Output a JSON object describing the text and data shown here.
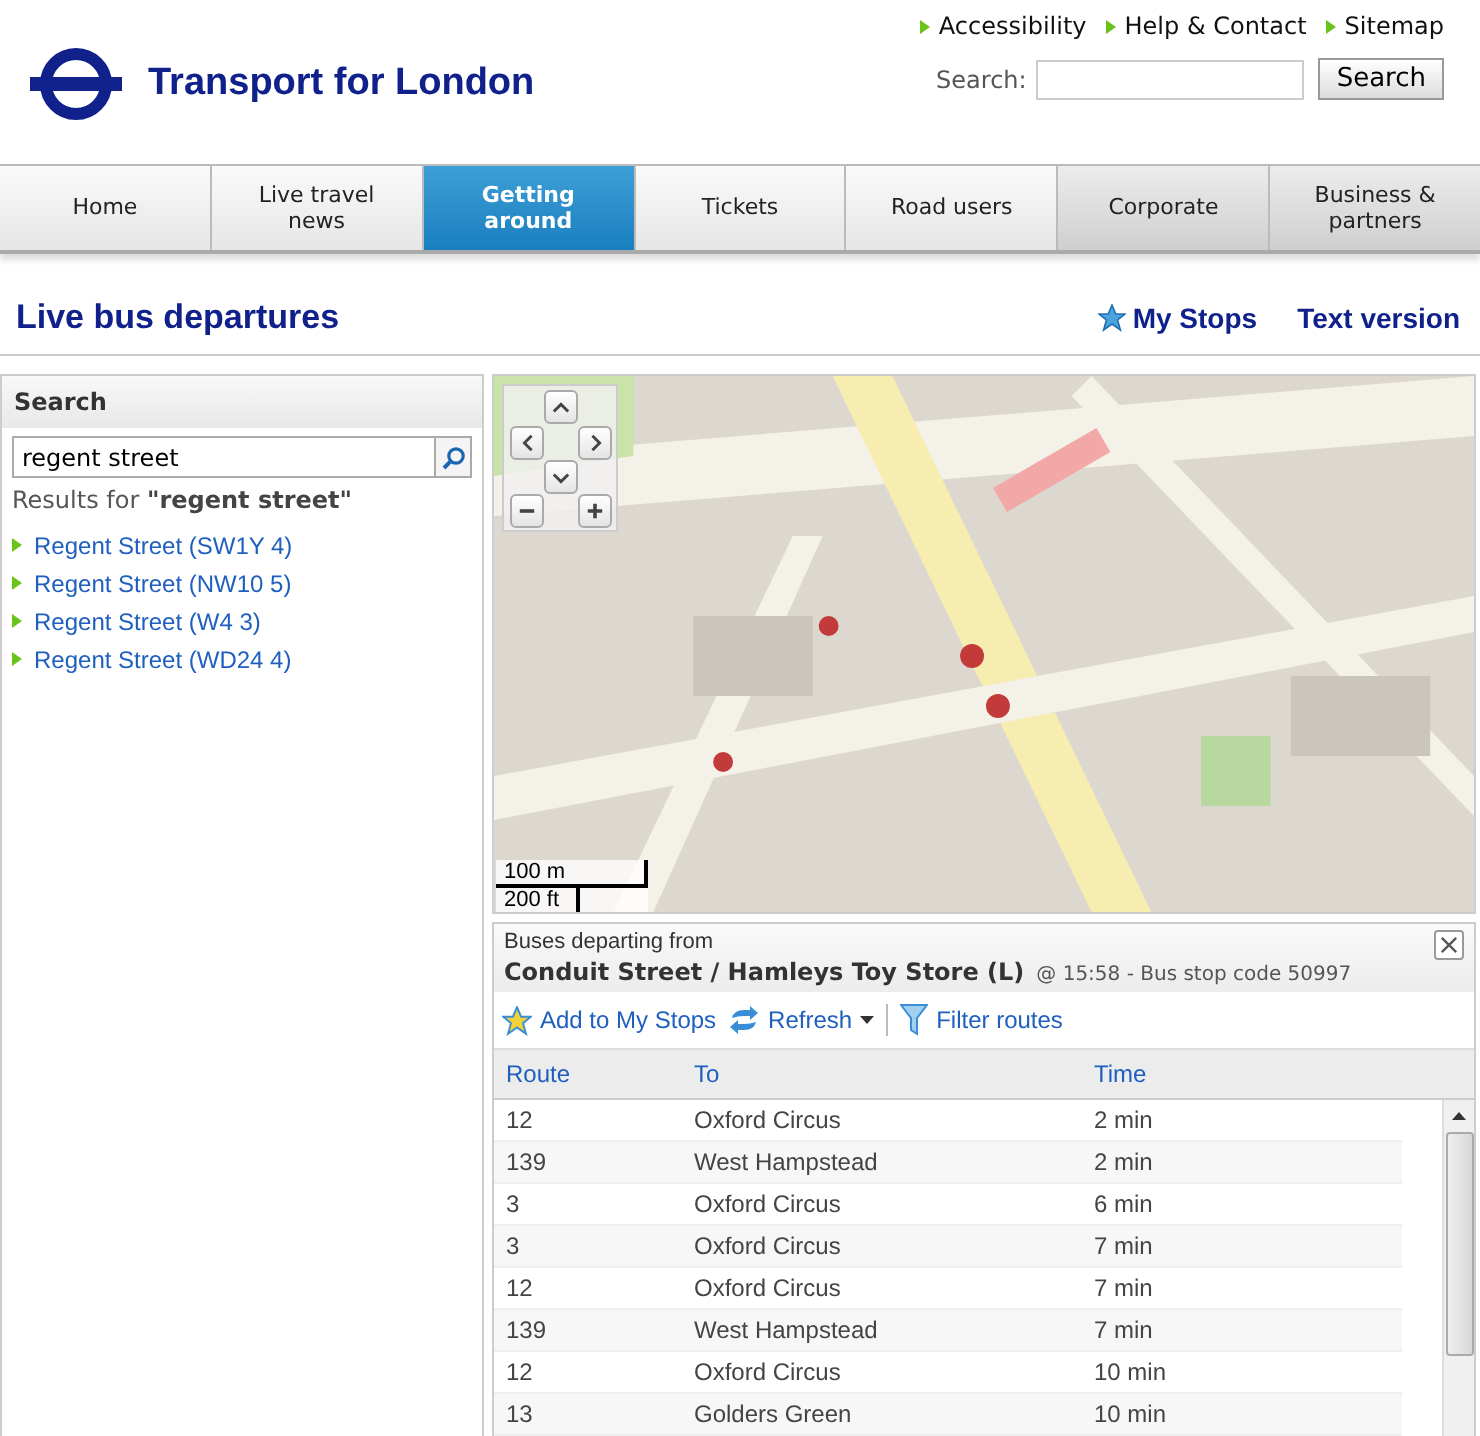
{
  "header": {
    "logo_text": "Transport for London",
    "utility_links": [
      "Accessibility",
      "Help & Contact",
      "Sitemap"
    ],
    "search": {
      "label": "Search:",
      "button": "Search"
    }
  },
  "nav": [
    {
      "label": "Home",
      "selected": false,
      "shaded": false
    },
    {
      "label": "Live travel news",
      "selected": false,
      "shaded": false
    },
    {
      "label": "Getting around",
      "selected": true,
      "shaded": false
    },
    {
      "label": "Tickets",
      "selected": false,
      "shaded": false
    },
    {
      "label": "Road users",
      "selected": false,
      "shaded": false
    },
    {
      "label": "Corporate",
      "selected": false,
      "shaded": true
    },
    {
      "label": "Business & partners",
      "selected": false,
      "shaded": true
    }
  ],
  "page": {
    "title": "Live bus departures",
    "links": [
      "My Stops",
      "Text version"
    ]
  },
  "search_panel": {
    "title": "Search",
    "value": "regent street",
    "results_prefix": "Results for",
    "results_query": "\"regent street\"",
    "results": [
      "Regent Street (SW1Y 4)",
      "Regent Street (NW10 5)",
      "Regent Street (W4 3)",
      "Regent Street (WD24 4)"
    ]
  },
  "map": {
    "kind": "picture",
    "scale": [
      "100 m",
      "200 ft"
    ]
  },
  "departures": {
    "caption": "Buses departing from",
    "stop_name": "Conduit Street / Hamleys Toy Store (L)",
    "stop_info": "@ 15:58 - Bus stop code 50997",
    "actions": [
      "Add to My Stops",
      "Refresh",
      "Filter routes"
    ],
    "columns": [
      "Route",
      "To",
      "Time"
    ],
    "rows": [
      [
        "12",
        "Oxford Circus",
        "2 min"
      ],
      [
        "139",
        "West Hampstead",
        "2 min"
      ],
      [
        "3",
        "Oxford Circus",
        "6 min"
      ],
      [
        "3",
        "Oxford Circus",
        "7 min"
      ],
      [
        "12",
        "Oxford Circus",
        "7 min"
      ],
      [
        "139",
        "West Hampstead",
        "7 min"
      ],
      [
        "12",
        "Oxford Circus",
        "10 min"
      ],
      [
        "13",
        "Golders Green",
        "10 min"
      ]
    ]
  }
}
